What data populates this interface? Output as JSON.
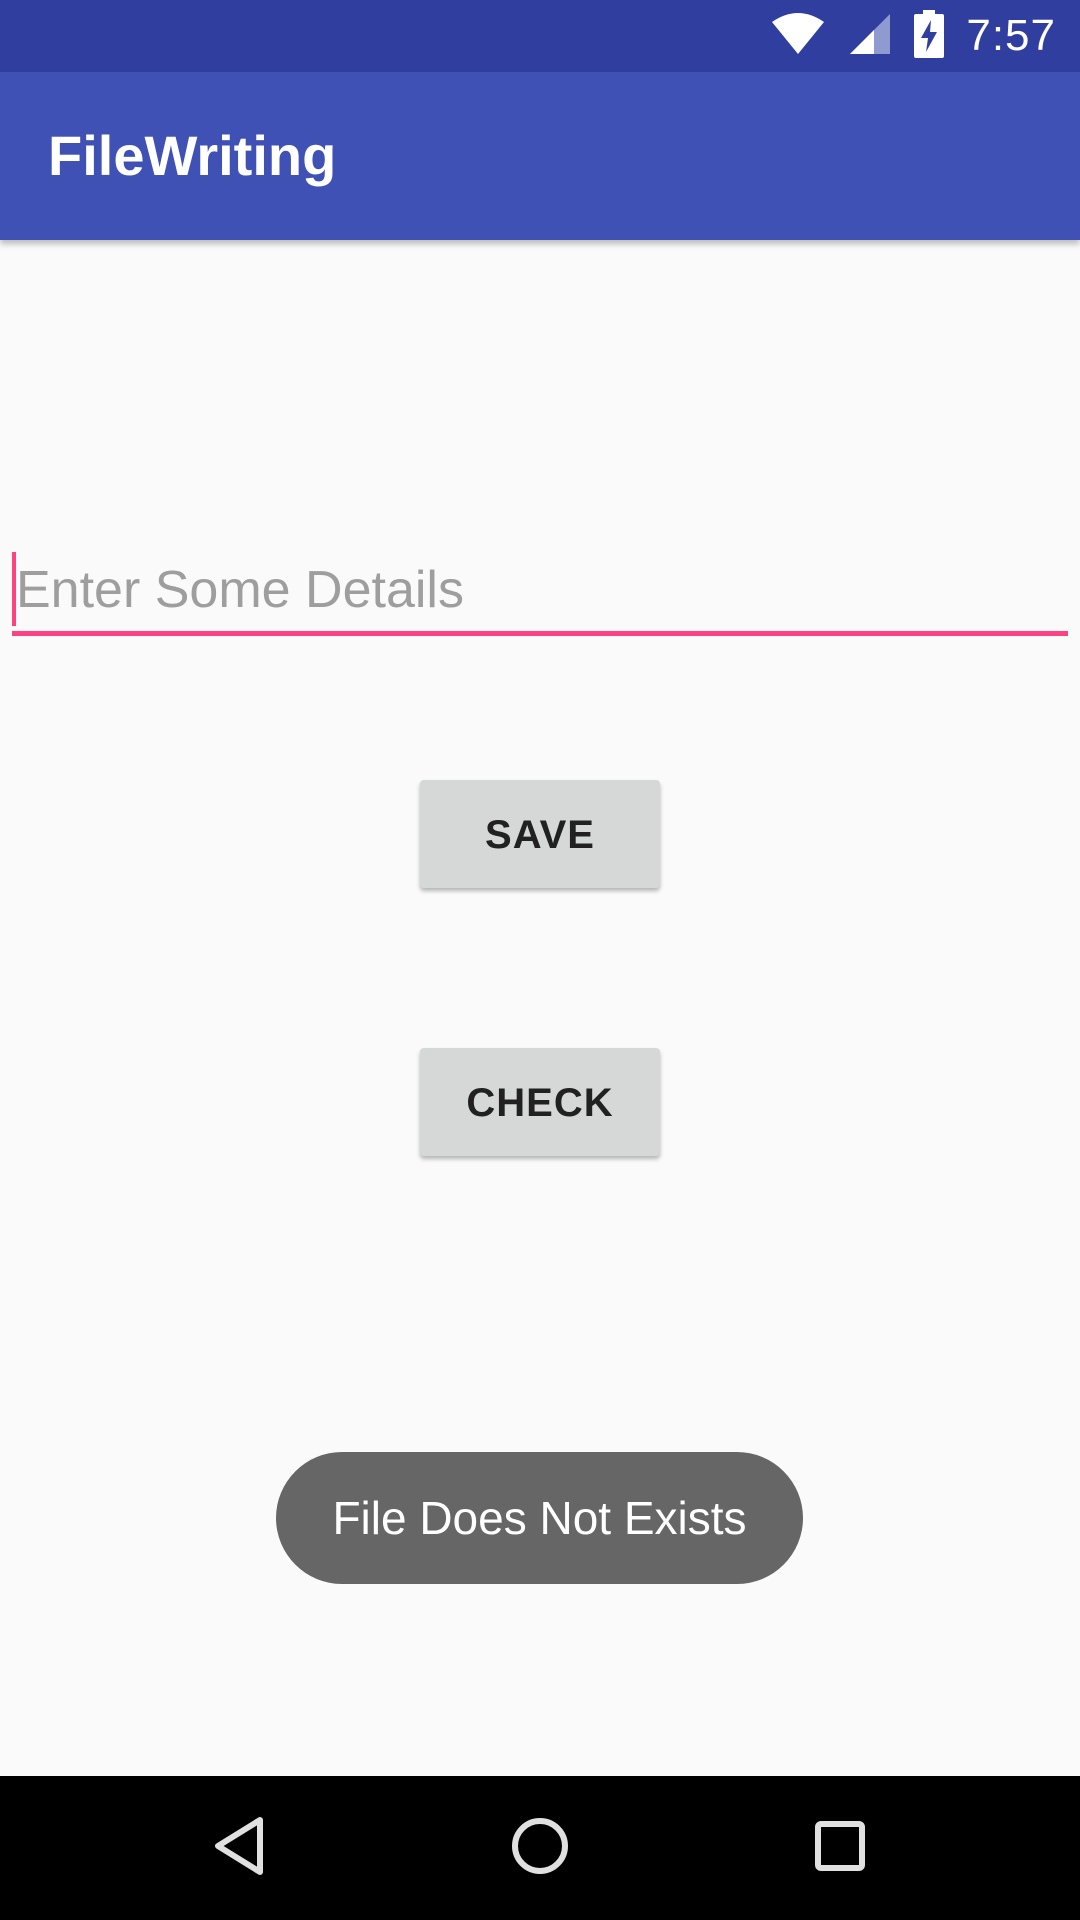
{
  "status_bar": {
    "time": "7:57",
    "icons": [
      "wifi-icon",
      "signal-icon",
      "battery-charging-icon"
    ],
    "color": "#303f9f"
  },
  "app_bar": {
    "title": "FileWriting",
    "color": "#3f51b5"
  },
  "form": {
    "input_placeholder": "Enter Some Details",
    "input_value": "",
    "accent_color": "#ff4081",
    "save_label": "SAVE",
    "check_label": "CHECK"
  },
  "toast": {
    "message": "File Does Not Exists"
  },
  "nav_bar": {
    "buttons": [
      "back-icon",
      "home-icon",
      "recents-icon"
    ]
  }
}
